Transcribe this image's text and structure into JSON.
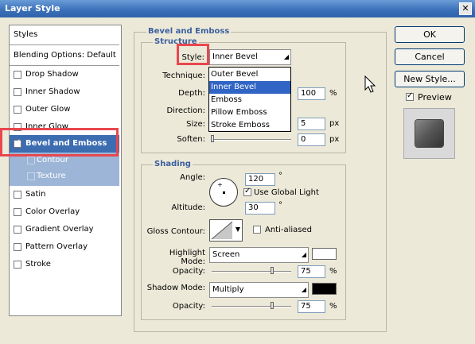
{
  "window": {
    "title": "Layer Style",
    "close_glyph": "✕"
  },
  "left_panel": {
    "styles": "Styles",
    "blending": "Blending Options: Default",
    "items": [
      {
        "label": "Drop Shadow",
        "checked": false
      },
      {
        "label": "Inner Shadow",
        "checked": false
      },
      {
        "label": "Outer Glow",
        "checked": false
      },
      {
        "label": "Inner Glow",
        "checked": false
      },
      {
        "label": "Bevel and Emboss",
        "checked": true,
        "selected": true
      },
      {
        "label": "Contour",
        "checked": false,
        "sub": true
      },
      {
        "label": "Texture",
        "checked": false,
        "sub": true
      },
      {
        "label": "Satin",
        "checked": false
      },
      {
        "label": "Color Overlay",
        "checked": false
      },
      {
        "label": "Gradient Overlay",
        "checked": false
      },
      {
        "label": "Pattern Overlay",
        "checked": false
      },
      {
        "label": "Stroke",
        "checked": false
      }
    ]
  },
  "bevel": {
    "title": "Bevel and Emboss",
    "structure": "Structure",
    "style_label": "Style:",
    "style_value": "Inner Bevel",
    "style_options": [
      "Outer Bevel",
      "Inner Bevel",
      "Emboss",
      "Pillow Emboss",
      "Stroke Emboss"
    ],
    "technique_label": "Technique:",
    "depth_label": "Depth:",
    "depth_value": "100",
    "depth_unit": "%",
    "direction_label": "Direction:",
    "size_label": "Size:",
    "size_value": "5",
    "size_unit": "px",
    "soften_label": "Soften:",
    "soften_value": "0",
    "soften_unit": "px"
  },
  "shading": {
    "title": "Shading",
    "angle_label": "Angle:",
    "angle_value": "120",
    "angle_unit": "°",
    "global_light_label": "Use Global Light",
    "global_light_checked": true,
    "altitude_label": "Altitude:",
    "altitude_value": "30",
    "altitude_unit": "°",
    "gloss_label": "Gloss Contour:",
    "anti_aliased_label": "Anti-aliased",
    "highlight_mode_label": "Highlight Mode:",
    "highlight_mode_value": "Screen",
    "highlight_color": "#ffffff",
    "opacity_label": "Opacity:",
    "highlight_opacity": "75",
    "shadow_mode_label": "Shadow Mode:",
    "shadow_mode_value": "Multiply",
    "shadow_color": "#000000",
    "shadow_opacity": "75",
    "opacity_unit": "%"
  },
  "buttons": {
    "ok": "OK",
    "cancel": "Cancel",
    "new_style": "New Style...",
    "preview": "Preview"
  },
  "colors": {
    "selection": "#3d6db1",
    "highlight_box": "#e8474f",
    "accent": "#3b5fa0"
  }
}
